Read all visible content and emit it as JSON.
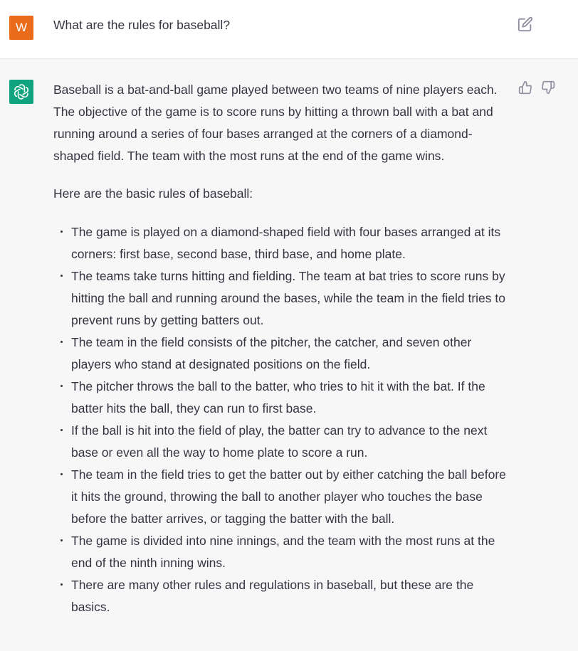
{
  "user_message": {
    "avatar_letter": "W",
    "text": "What are the rules for baseball?"
  },
  "assistant_message": {
    "intro": "Baseball is a bat-and-ball game played between two teams of nine players each. The objective of the game is to score runs by hitting a thrown ball with a bat and running around a series of four bases arranged at the corners of a diamond-shaped field. The team with the most runs at the end of the game wins.",
    "subheading": "Here are the basic rules of baseball:",
    "rules": [
      "The game is played on a diamond-shaped field with four bases arranged at its corners: first base, second base, third base, and home plate.",
      "The teams take turns hitting and fielding. The team at bat tries to score runs by hitting the ball and running around the bases, while the team in the field tries to prevent runs by getting batters out.",
      "The team in the field consists of the pitcher, the catcher, and seven other players who stand at designated positions on the field.",
      "The pitcher throws the ball to the batter, who tries to hit it with the bat. If the batter hits the ball, they can run to first base.",
      "If the ball is hit into the field of play, the batter can try to advance to the next base or even all the way to home plate to score a run.",
      "The team in the field tries to get the batter out by either catching the ball before it hits the ground, throwing the ball to another player who touches the base before the batter arrives, or tagging the batter with the ball.",
      "The game is divided into nine innings, and the team with the most runs at the end of the ninth inning wins.",
      "There are many other rules and regulations in baseball, but these are the basics."
    ]
  },
  "icons": {
    "edit": "edit-icon",
    "assistant_logo": "openai-logo-icon",
    "thumbs_up": "thumbs-up-icon",
    "thumbs_down": "thumbs-down-icon"
  },
  "colors": {
    "user_avatar": "#ea6b1a",
    "assistant_avatar": "#10a37f",
    "user_row_bg": "#ffffff",
    "assistant_row_bg": "#f7f7f8",
    "text": "#343541",
    "icon": "#8e8ea0"
  }
}
